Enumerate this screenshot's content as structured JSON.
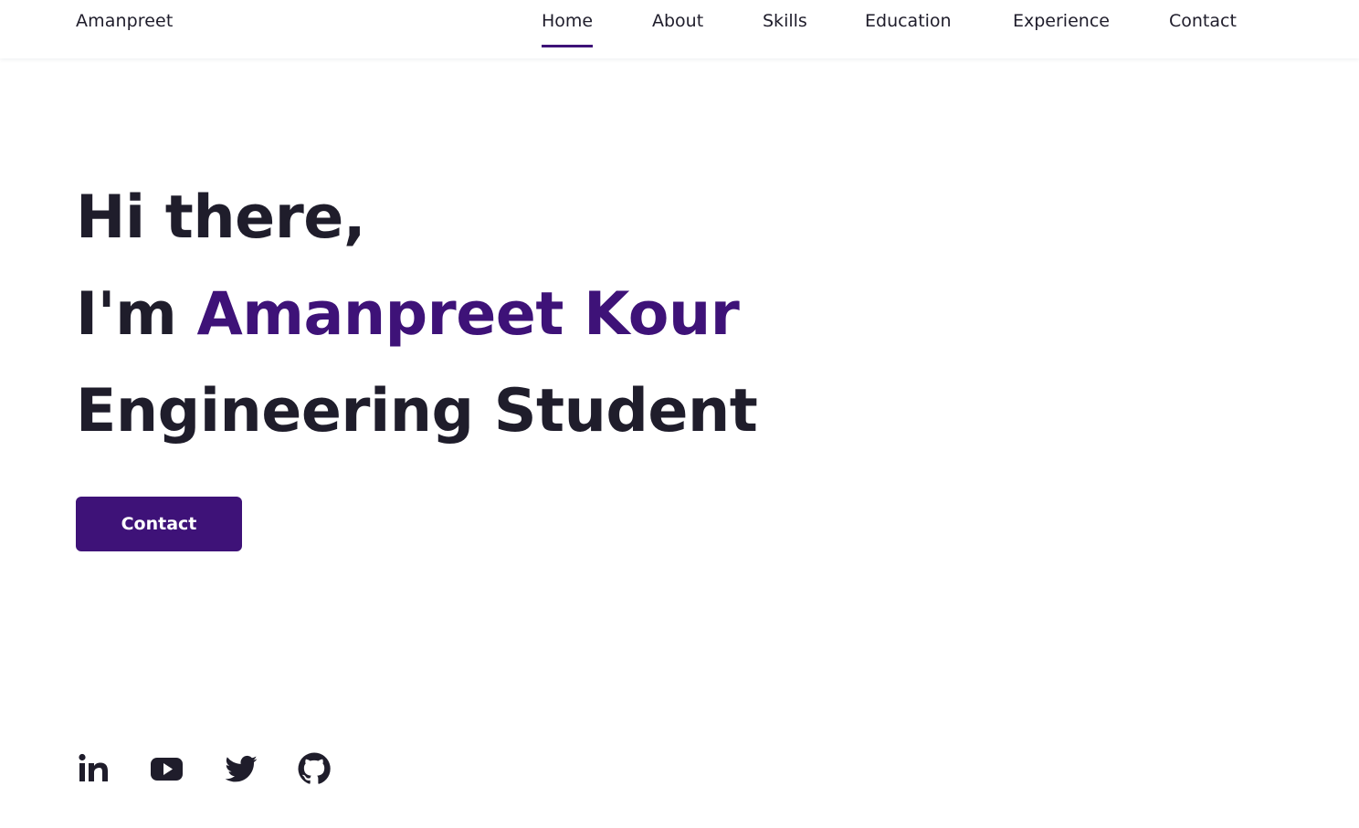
{
  "header": {
    "logo": "Amanpreet",
    "nav": [
      {
        "label": "Home",
        "active": true
      },
      {
        "label": "About",
        "active": false
      },
      {
        "label": "Skills",
        "active": false
      },
      {
        "label": "Education",
        "active": false
      },
      {
        "label": "Experience",
        "active": false
      },
      {
        "label": "Contact",
        "active": false
      }
    ]
  },
  "hero": {
    "greeting": "Hi there,",
    "intro_prefix": "I'm ",
    "name": "Amanpreet Kour",
    "role": "Engineering Student",
    "cta_label": "Contact"
  },
  "social": [
    {
      "icon": "linkedin-icon"
    },
    {
      "icon": "youtube-icon"
    },
    {
      "icon": "twitter-icon"
    },
    {
      "icon": "github-icon"
    }
  ],
  "colors": {
    "accent": "#3e1278",
    "text": "#1f1d2b",
    "background": "#ffffff"
  }
}
